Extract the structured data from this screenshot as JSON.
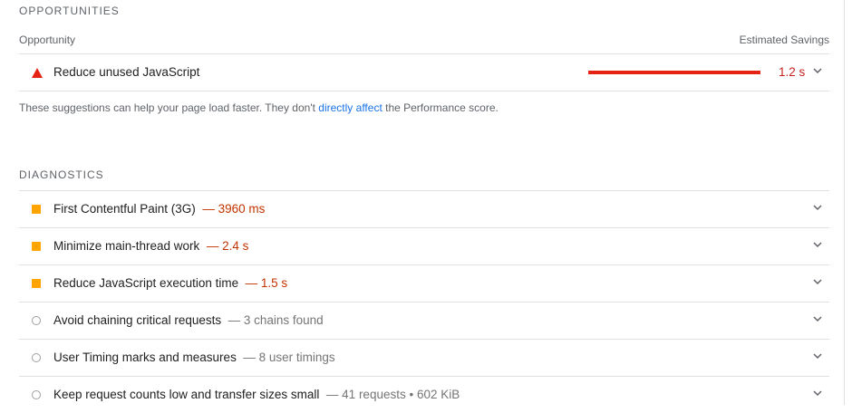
{
  "opportunities": {
    "section_title": "OPPORTUNITIES",
    "column_left": "Opportunity",
    "column_right": "Estimated Savings",
    "items": [
      {
        "title": "Reduce unused JavaScript",
        "savings": "1.2 s",
        "severity": "fail",
        "icon": "warning-triangle-icon"
      }
    ],
    "note_before": "These suggestions can help your page load faster. They don't ",
    "note_link": "directly affect",
    "note_after": " the Performance score."
  },
  "diagnostics": {
    "section_title": "DIAGNOSTICS",
    "items": [
      {
        "title": "First Contentful Paint (3G)",
        "value": "— 3960 ms",
        "severity": "average",
        "icon": "orange-square-icon"
      },
      {
        "title": "Minimize main-thread work",
        "value": "— 2.4 s",
        "severity": "average",
        "icon": "orange-square-icon"
      },
      {
        "title": "Reduce JavaScript execution time",
        "value": "— 1.5 s",
        "severity": "average",
        "icon": "orange-square-icon"
      },
      {
        "title": "Avoid chaining critical requests",
        "value": "— 3 chains found",
        "severity": "info",
        "icon": "info-circle-icon"
      },
      {
        "title": "User Timing marks and measures",
        "value": "— 8 user timings",
        "severity": "info",
        "icon": "info-circle-icon"
      },
      {
        "title": "Keep request counts low and transfer sizes small",
        "value": "— 41 requests • 602 KiB",
        "severity": "info",
        "icon": "info-circle-icon"
      }
    ]
  },
  "colors": {
    "fail": "#e52315",
    "average": "#ffa400",
    "link": "#1a73e8"
  }
}
